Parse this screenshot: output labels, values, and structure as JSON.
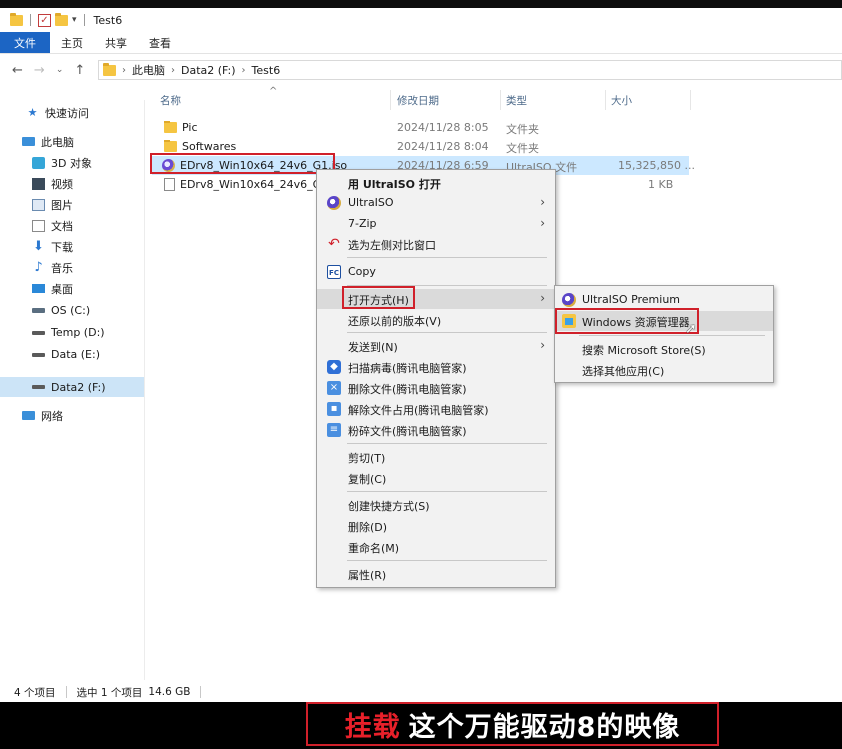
{
  "title_bar": {
    "title": "Test6"
  },
  "ribbon": {
    "tabs": [
      "文件",
      "主页",
      "共享",
      "查看"
    ]
  },
  "address": {
    "crumbs": [
      "此电脑",
      "Data2 (F:)",
      "Test6"
    ]
  },
  "sidebar": {
    "items": [
      {
        "label": "快速访问",
        "icon": "pin-icon"
      },
      {
        "label": "此电脑",
        "icon": "computer-icon"
      },
      {
        "label": "3D 对象",
        "icon": "3d-objects-icon"
      },
      {
        "label": "视频",
        "icon": "video-icon"
      },
      {
        "label": "图片",
        "icon": "pictures-icon"
      },
      {
        "label": "文档",
        "icon": "documents-icon"
      },
      {
        "label": "下载",
        "icon": "download-icon"
      },
      {
        "label": "音乐",
        "icon": "music-icon"
      },
      {
        "label": "桌面",
        "icon": "desktop-icon"
      },
      {
        "label": "OS (C:)",
        "icon": "drive-icon"
      },
      {
        "label": "Temp (D:)",
        "icon": "drive-icon"
      },
      {
        "label": "Data (E:)",
        "icon": "drive-icon"
      },
      {
        "label": "Data2 (F:)",
        "icon": "drive-icon",
        "selected": true
      },
      {
        "label": "网络",
        "icon": "network-icon"
      }
    ]
  },
  "file_list": {
    "headers": {
      "name": "名称",
      "date": "修改日期",
      "type": "类型",
      "size": "大小"
    },
    "files": [
      {
        "name": "Pic",
        "date": "2024/11/28 8:05",
        "type": "文件夹",
        "size": "",
        "icon": "folder-icon"
      },
      {
        "name": "Softwares",
        "date": "2024/11/28 8:04",
        "type": "文件夹",
        "size": "",
        "icon": "folder-icon"
      },
      {
        "name": "EDrv8_Win10x64_24v6_G1.iso",
        "date": "2024/11/28 6:59",
        "type": "UltraISO 文件",
        "size": "15,325,850 ...",
        "icon": "iso-icon",
        "selected": true
      },
      {
        "name": "EDrv8_Win10x64_24v6_G1.",
        "date": "",
        "type": "",
        "size": "1 KB",
        "icon": "document-icon"
      }
    ]
  },
  "context_menu": {
    "items": [
      {
        "label": "用 UltraISO 打开",
        "icon": "",
        "bold": true
      },
      {
        "label": "UltraISO",
        "icon": "ultraiso-icon",
        "arrow": true
      },
      {
        "label": "7-Zip",
        "icon": "",
        "arrow": true
      },
      {
        "label": "选为左侧对比窗口",
        "icon": "compare-icon"
      },
      {
        "label": "Copy",
        "icon": "fastcopy-icon"
      },
      {
        "label": "打开方式(H)",
        "icon": "",
        "arrow": true,
        "highlighted": true
      },
      {
        "label": "还原以前的版本(V)",
        "icon": ""
      },
      {
        "label": "发送到(N)",
        "icon": "",
        "arrow": true
      },
      {
        "label": "扫描病毒(腾讯电脑管家)",
        "icon": "shield-icon"
      },
      {
        "label": "删除文件(腾讯电脑管家)",
        "icon": "delete-file-icon"
      },
      {
        "label": "解除文件占用(腾讯电脑管家)",
        "icon": "unlock-file-icon"
      },
      {
        "label": "粉碎文件(腾讯电脑管家)",
        "icon": "shred-icon"
      },
      {
        "label": "剪切(T)",
        "icon": ""
      },
      {
        "label": "复制(C)",
        "icon": ""
      },
      {
        "label": "创建快捷方式(S)",
        "icon": ""
      },
      {
        "label": "删除(D)",
        "icon": ""
      },
      {
        "label": "重命名(M)",
        "icon": ""
      },
      {
        "label": "属性(R)",
        "icon": ""
      }
    ]
  },
  "open_with_menu": {
    "items": [
      {
        "label": "UltraISO Premium",
        "icon": "ultraiso-icon"
      },
      {
        "label": "Windows 资源管理器",
        "icon": "explorer-icon",
        "highlighted": true
      },
      {
        "label": "搜索 Microsoft Store(S)",
        "icon": ""
      },
      {
        "label": "选择其他应用(C)",
        "icon": ""
      }
    ]
  },
  "status_bar": {
    "item_count": "4 个项目",
    "selected": "选中 1 个项目",
    "size": "14.6 GB"
  },
  "caption": {
    "highlight": "挂载",
    "text": "这个万能驱动8的映像"
  },
  "colors": {
    "accent": "#1c65c4",
    "selection": "#cce8ff",
    "annotation": "#d0202a"
  }
}
